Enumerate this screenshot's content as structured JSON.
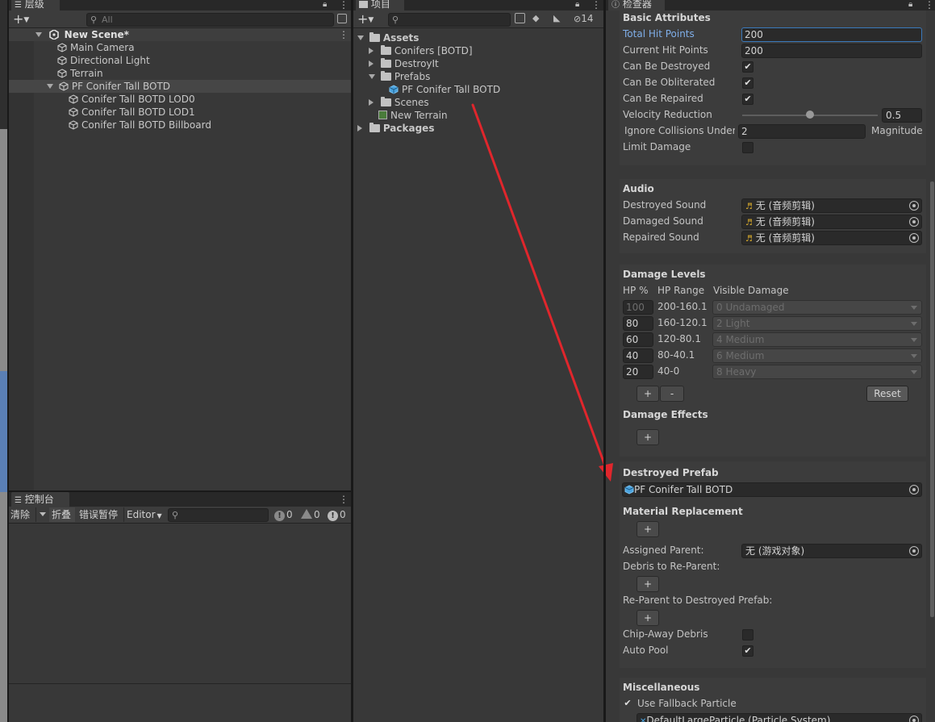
{
  "hierarchy": {
    "tab_label": "层级",
    "search_placeholder": "All",
    "scene_name": "New Scene*",
    "items": [
      {
        "label": "Main Camera"
      },
      {
        "label": "Directional Light"
      },
      {
        "label": "Terrain"
      },
      {
        "label": "PF Conifer Tall BOTD"
      },
      {
        "label": "Conifer Tall BOTD LOD0"
      },
      {
        "label": "Conifer Tall BOTD LOD1"
      },
      {
        "label": "Conifer Tall BOTD Billboard"
      }
    ]
  },
  "console": {
    "tab_label": "控制台",
    "clear_label": "清除",
    "collapse_label": "折叠",
    "error_pause_label": "错误暂停",
    "editor_label": "Editor",
    "log_count": "0",
    "warning_count": "0",
    "error_count": "0"
  },
  "project": {
    "tab_label": "项目",
    "hidden_count": "14",
    "tree": [
      {
        "label": "Assets"
      },
      {
        "label": "Conifers [BOTD]"
      },
      {
        "label": "DestroyIt"
      },
      {
        "label": "Prefabs"
      },
      {
        "label": "PF Conifer Tall BOTD"
      },
      {
        "label": "Scenes"
      },
      {
        "label": "New Terrain"
      },
      {
        "label": "Packages"
      }
    ]
  },
  "inspector": {
    "tab_label": "检查器",
    "basic": {
      "title": "Basic Attributes",
      "total_hp_label": "Total Hit Points",
      "total_hp_value": "200",
      "current_hp_label": "Current Hit Points",
      "current_hp_value": "200",
      "can_destroy_label": "Can Be Destroyed",
      "can_obliterate_label": "Can Be Obliterated",
      "can_repair_label": "Can Be Repaired",
      "velocity_label": "Velocity Reduction",
      "velocity_value": "0.5",
      "velocity_fraction": 0.5,
      "ignore_label": "Ignore Collisions Under",
      "ignore_value": "2",
      "magnitude_label": "Magnitude",
      "limit_label": "Limit Damage"
    },
    "audio": {
      "title": "Audio",
      "destroyed_label": "Destroyed Sound",
      "damaged_label": "Damaged Sound",
      "repaired_label": "Repaired Sound",
      "none_clip": "无 (音频剪辑)"
    },
    "damage_levels": {
      "title": "Damage Levels",
      "col_hp": "HP %",
      "col_range": "HP Range",
      "col_visible": "Visible Damage",
      "rows": [
        {
          "hp": "100",
          "range": "200-160.1",
          "visible": "0 Undamaged"
        },
        {
          "hp": "80",
          "range": "160-120.1",
          "visible": "2 Light"
        },
        {
          "hp": "60",
          "range": "120-80.1",
          "visible": "4 Medium"
        },
        {
          "hp": "40",
          "range": "80-40.1",
          "visible": "6 Medium"
        },
        {
          "hp": "20",
          "range": "40-0",
          "visible": "8 Heavy"
        }
      ],
      "add_label": "+",
      "remove_label": "-",
      "reset_label": "Reset"
    },
    "damage_effects": {
      "title": "Damage Effects",
      "add_label": "+"
    },
    "destroyed_prefab": {
      "title": "Destroyed Prefab",
      "value": "PF Conifer Tall BOTD"
    },
    "material_replacement": {
      "title": "Material Replacement",
      "add_label": "+",
      "assigned_parent_label": "Assigned Parent:",
      "assigned_parent_value": "无 (游戏对象)",
      "debris_label": "Debris to Re-Parent:",
      "reparent_label": "Re-Parent to Destroyed Prefab:",
      "chip_label": "Chip-Away Debris",
      "auto_pool_label": "Auto Pool"
    },
    "misc": {
      "title": "Miscellaneous",
      "fallback_label": "Use Fallback Particle",
      "particle_value": "DefaultLargeParticle (Particle System)"
    }
  },
  "colors": {
    "accent_blue": "#3a79bb",
    "arrow_red": "#e0262c",
    "panel_bg": "#383838"
  }
}
